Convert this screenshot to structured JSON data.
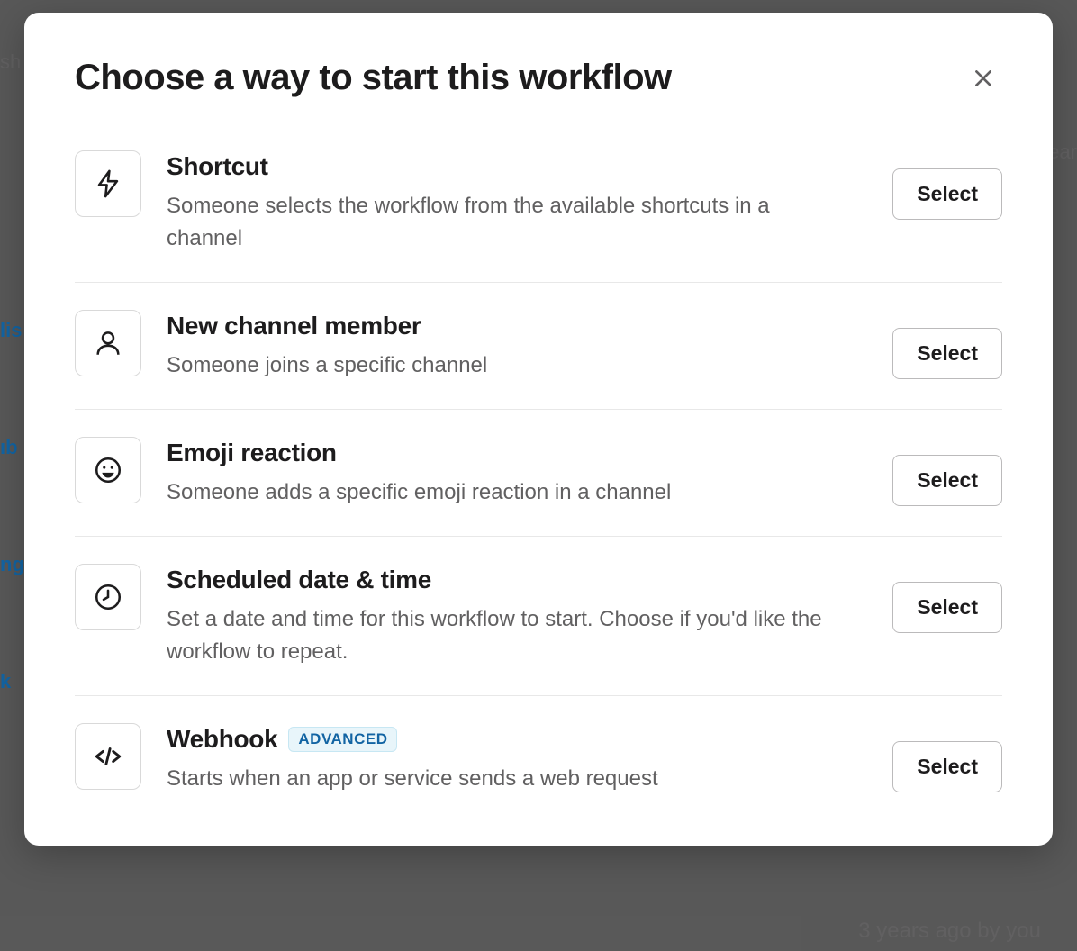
{
  "modal": {
    "title": "Choose a way to start this workflow",
    "select_label": "Select",
    "triggers": [
      {
        "icon": "lightning-icon",
        "title": "Shortcut",
        "description": "Someone selects the workflow from the available shortcuts in a channel"
      },
      {
        "icon": "person-icon",
        "title": "New channel member",
        "description": "Someone joins a specific channel"
      },
      {
        "icon": "smiley-icon",
        "title": "Emoji reaction",
        "description": "Someone adds a specific emoji reaction in a channel"
      },
      {
        "icon": "clock-icon",
        "title": "Scheduled date & time",
        "description": "Set a date and time for this workflow to start. Choose if you'd like the workflow to repeat."
      },
      {
        "icon": "code-icon",
        "title": "Webhook",
        "badge": "ADVANCED",
        "description": "Starts when an app or service sends a web request"
      }
    ]
  },
  "background": {
    "footer_text": "3 years ago by you"
  }
}
